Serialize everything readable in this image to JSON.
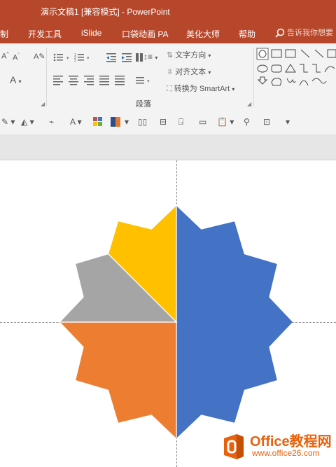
{
  "window": {
    "title": "演示文稿1 [兼容模式]  -  PowerPoint"
  },
  "tabs": [
    {
      "label": "制"
    },
    {
      "label": "开发工具"
    },
    {
      "label": "iSlide"
    },
    {
      "label": "口袋动画 PA"
    },
    {
      "label": "美化大师"
    },
    {
      "label": "帮助"
    }
  ],
  "tell_me": {
    "placeholder": "告诉我你想要"
  },
  "ribbon": {
    "text_direction": "文字方向",
    "align_text": "对齐文本",
    "convert_smartart": "转换为 SmartArt",
    "paragraph_group": "段落"
  },
  "chart_data": {
    "type": "pie",
    "shape": "12-point star",
    "slices": [
      {
        "color": "#4472c4",
        "fraction": 0.5
      },
      {
        "color": "#ed7d31",
        "fraction": 0.25
      },
      {
        "color": "#a5a5a5",
        "fraction": 0.125
      },
      {
        "color": "#ffc000",
        "fraction": 0.125
      }
    ]
  },
  "watermark": {
    "brand": "Office教程网",
    "url": "www.office26.com"
  },
  "colors": {
    "titlebar": "#b7472a",
    "ribbon": "#f3f3f3",
    "blue": "#4472c4",
    "orange": "#ed7d31",
    "gray": "#a5a5a5",
    "gold": "#ffc000"
  }
}
